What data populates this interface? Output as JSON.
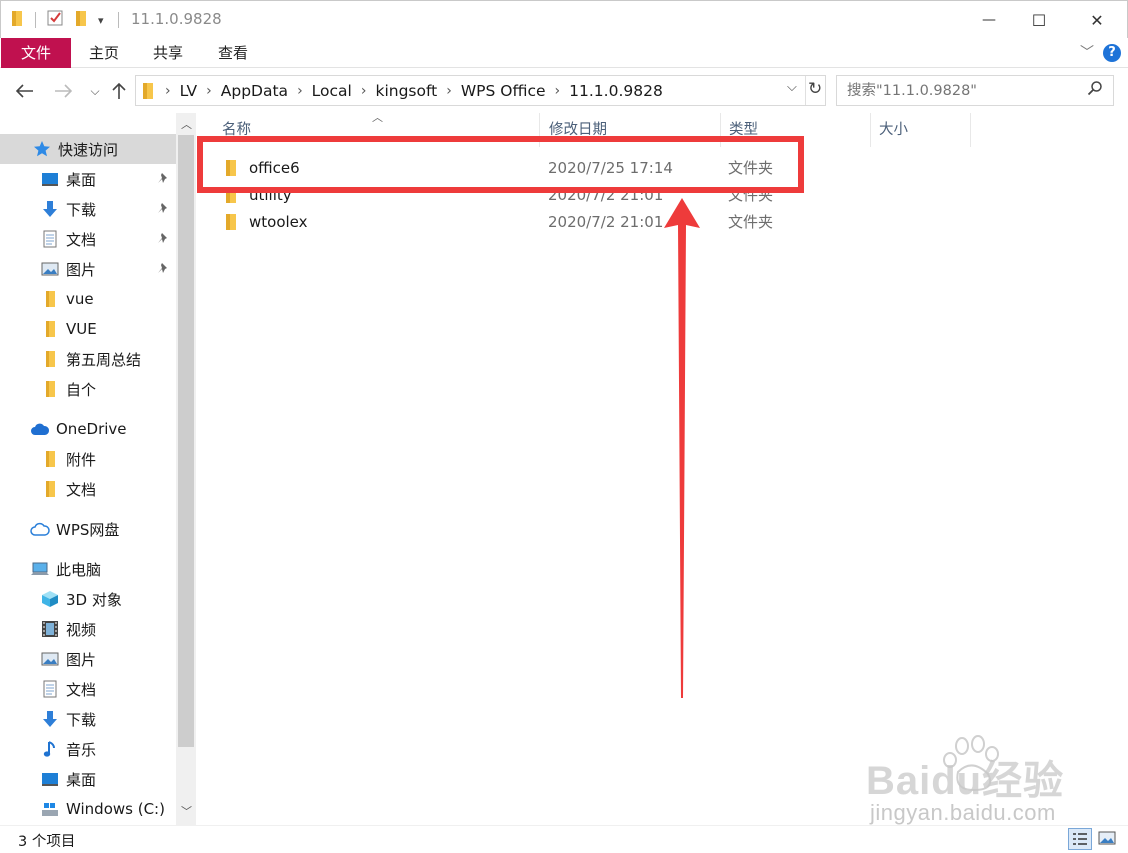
{
  "window": {
    "title": "11.1.0.9828",
    "minimize_glyph": "—",
    "maximize_glyph": "☐",
    "close_glyph": "✕"
  },
  "ribbon": {
    "tabs": [
      {
        "label": "文件",
        "active": true
      },
      {
        "label": "主页"
      },
      {
        "label": "共享"
      },
      {
        "label": "查看"
      }
    ],
    "accent_color": "#c0114f"
  },
  "address": {
    "breadcrumbs": [
      "LV",
      "AppData",
      "Local",
      "kingsoft",
      "WPS Office",
      "11.1.0.9828"
    ]
  },
  "search": {
    "placeholder": "搜索\"11.1.0.9828\""
  },
  "nav": {
    "items": [
      {
        "label": "快速访问",
        "icon": "star-icon",
        "selected": true
      },
      {
        "label": "桌面",
        "icon": "desktop-icon",
        "pinned": true
      },
      {
        "label": "下载",
        "icon": "download-arrow-icon",
        "pinned": true
      },
      {
        "label": "文档",
        "icon": "document-icon",
        "pinned": true
      },
      {
        "label": "图片",
        "icon": "picture-icon",
        "pinned": true
      },
      {
        "label": "vue",
        "icon": "folder-icon"
      },
      {
        "label": "VUE",
        "icon": "folder-icon"
      },
      {
        "label": "第五周总结",
        "icon": "folder-icon"
      },
      {
        "label": "自个",
        "icon": "folder-icon"
      },
      {
        "label": "OneDrive",
        "icon": "cloud-icon"
      },
      {
        "label": "附件",
        "icon": "folder-icon"
      },
      {
        "label": "文档",
        "icon": "folder-icon"
      },
      {
        "label": "WPS网盘",
        "icon": "cloud-outline-icon"
      },
      {
        "label": "此电脑",
        "icon": "computer-icon"
      },
      {
        "label": "3D 对象",
        "icon": "cube-icon"
      },
      {
        "label": "视频",
        "icon": "film-icon"
      },
      {
        "label": "图片",
        "icon": "picture-icon"
      },
      {
        "label": "文档",
        "icon": "document-icon"
      },
      {
        "label": "下载",
        "icon": "download-arrow-icon"
      },
      {
        "label": "音乐",
        "icon": "music-note-icon"
      },
      {
        "label": "桌面",
        "icon": "desktop-icon"
      },
      {
        "label": "Windows (C:)",
        "icon": "drive-icon"
      }
    ]
  },
  "columns": [
    "名称",
    "修改日期",
    "类型",
    "大小"
  ],
  "files": [
    {
      "name": "office6",
      "modified": "2020/7/25 17:14",
      "type": "文件夹"
    },
    {
      "name": "utility",
      "modified": "2020/7/2 21:01",
      "type": "文件夹"
    },
    {
      "name": "wtoolex",
      "modified": "2020/7/2 21:01",
      "type": "文件夹"
    }
  ],
  "status": {
    "item_count": "3 个项目"
  },
  "watermark": {
    "brand": "Baidu经验",
    "url": "jingyan.baidu.com"
  },
  "colors": {
    "folder": "#f7c64b",
    "annotation": "#ee3b3b",
    "selection": "#d9d9d9"
  }
}
